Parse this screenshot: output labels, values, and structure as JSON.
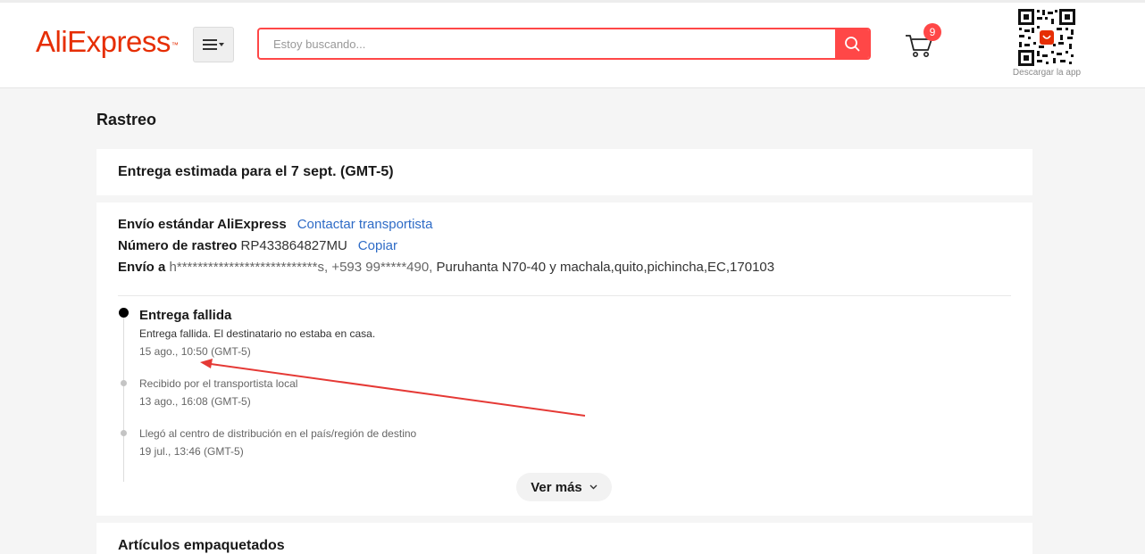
{
  "header": {
    "logo": "AliExpress",
    "logo_mark": "™",
    "search_placeholder": "Estoy buscando...",
    "cart_count": "9",
    "qr_label": "Descargar la app"
  },
  "page": {
    "title": "Rastreo"
  },
  "estimate": {
    "text": "Entrega estimada para el 7 sept. (GMT-5)"
  },
  "shipping": {
    "method_label": "Envío estándar AliExpress",
    "contact_link": "Contactar transportista",
    "tracking_label": "Número de rastreo",
    "tracking_number": "RP433864827MU",
    "copy_link": "Copiar",
    "ship_to_label": "Envío a",
    "recipient": "h***************************s,",
    "phone": "+593 99*****490,",
    "address": "Puruhanta N70-40 y machala,quito,pichincha,EC,170103"
  },
  "events": [
    {
      "title": "Entrega fallida",
      "description": "Entrega fallida. El destinatario no estaba en casa.",
      "date": "15 ago., 10:50 (GMT-5)"
    },
    {
      "title": "Recibido por el transportista local",
      "date": "13 ago., 16:08 (GMT-5)"
    },
    {
      "title": "Llegó al centro de distribución en el país/región de destino",
      "date": "19 jul., 13:46 (GMT-5)"
    }
  ],
  "more_button": "Ver más",
  "packed_items": {
    "title": "Artículos empaquetados"
  },
  "colors": {
    "brand": "#e62e04",
    "search_accent": "#ff4747",
    "link": "#2e6bc6",
    "annotation_arrow": "#e53935"
  }
}
